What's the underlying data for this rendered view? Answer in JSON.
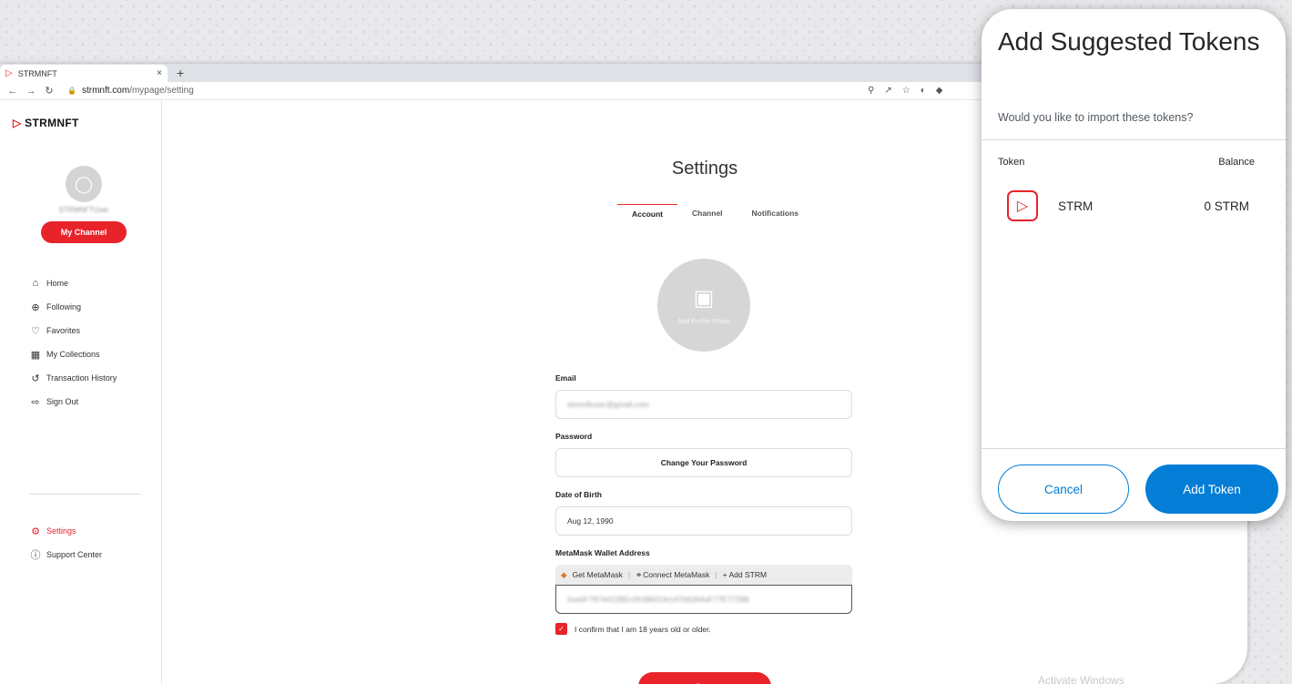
{
  "browser": {
    "tab_title": "STRMNFT",
    "tab_close": "×",
    "new_tab": "+",
    "url_host": "strmnft.com",
    "url_path": "/mypage/setting"
  },
  "sidebar": {
    "brand_prefix": "STRM",
    "brand_suffix": "NFT",
    "username": "STRMNFTUser",
    "my_channel": "My Channel",
    "items": [
      {
        "label": "Home",
        "icon": "home-icon"
      },
      {
        "label": "Following",
        "icon": "plus-circle-icon"
      },
      {
        "label": "Favorites",
        "icon": "heart-icon"
      },
      {
        "label": "My Collections",
        "icon": "grid-icon"
      },
      {
        "label": "Transaction History",
        "icon": "history-icon"
      },
      {
        "label": "Sign Out",
        "icon": "sign-out-icon"
      }
    ],
    "bottom_items": [
      {
        "label": "Settings",
        "icon": "gear-icon"
      },
      {
        "label": "Support Center",
        "icon": "help-icon"
      }
    ]
  },
  "settings": {
    "title": "Settings",
    "tabs": [
      "Account",
      "Channel",
      "Notifications"
    ],
    "add_photo": "Add Profile Photo",
    "email_label": "Email",
    "email_value": "strmnftuser@gmail.com",
    "password_label": "Password",
    "change_password": "Change Your Password",
    "dob_label": "Date of Birth",
    "dob_value": "Aug 12, 1990",
    "wallet_label": "MetaMask Wallet Address",
    "get_metamask": "Get MetaMask",
    "connect_metamask": "Connect MetaMask",
    "add_strm": "+ Add STRM",
    "wallet_value": "0xe0F7874422BEc0538631fe147b9264aF77E7728B",
    "confirm_text": "I confirm that I am 18 years old or older.",
    "save": "Save"
  },
  "watermark": "Activate Windows",
  "popup": {
    "title": "Add Suggested Tokens",
    "subtitle": "Would you like to import these tokens?",
    "col_token": "Token",
    "col_balance": "Balance",
    "token_name": "STRM",
    "token_balance": "0 STRM",
    "cancel": "Cancel",
    "add_token": "Add Token"
  },
  "colors": {
    "brand_red": "#e8232a",
    "metamask_blue": "#037dd6"
  }
}
